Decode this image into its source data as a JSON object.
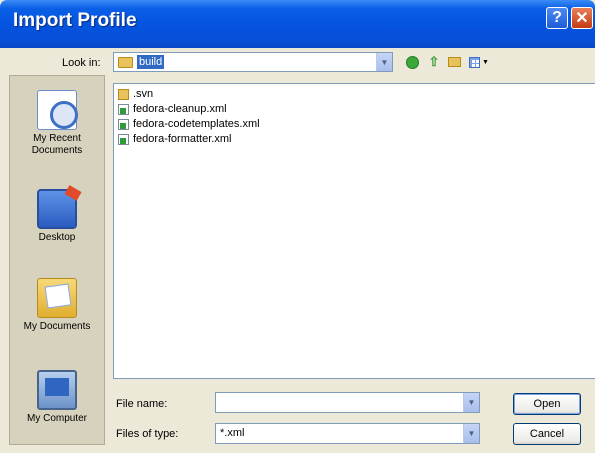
{
  "window": {
    "title": "Import Profile",
    "help_glyph": "?",
    "close_glyph": "✕"
  },
  "look_in": {
    "label": "Look in:",
    "value": "build"
  },
  "places": [
    {
      "label": "My Recent Documents",
      "icon": "recent-documents-icon"
    },
    {
      "label": "Desktop",
      "icon": "desktop-icon"
    },
    {
      "label": "My Documents",
      "icon": "my-documents-icon"
    },
    {
      "label": "My Computer",
      "icon": "my-computer-icon"
    }
  ],
  "files": [
    {
      "name": ".svn",
      "type": "folder"
    },
    {
      "name": "fedora-cleanup.xml",
      "type": "xml"
    },
    {
      "name": "fedora-codetemplates.xml",
      "type": "xml"
    },
    {
      "name": "fedora-formatter.xml",
      "type": "xml"
    }
  ],
  "file_name": {
    "label": "File name:",
    "value": ""
  },
  "files_of_type": {
    "label": "Files of type:",
    "value": "*.xml"
  },
  "buttons": {
    "open": "Open",
    "cancel": "Cancel"
  },
  "colors": {
    "titlebar": "#0554E0",
    "selection": "#316AC5",
    "dialog_bg": "#ECE9D8",
    "places_bg": "#D7D2BD"
  }
}
